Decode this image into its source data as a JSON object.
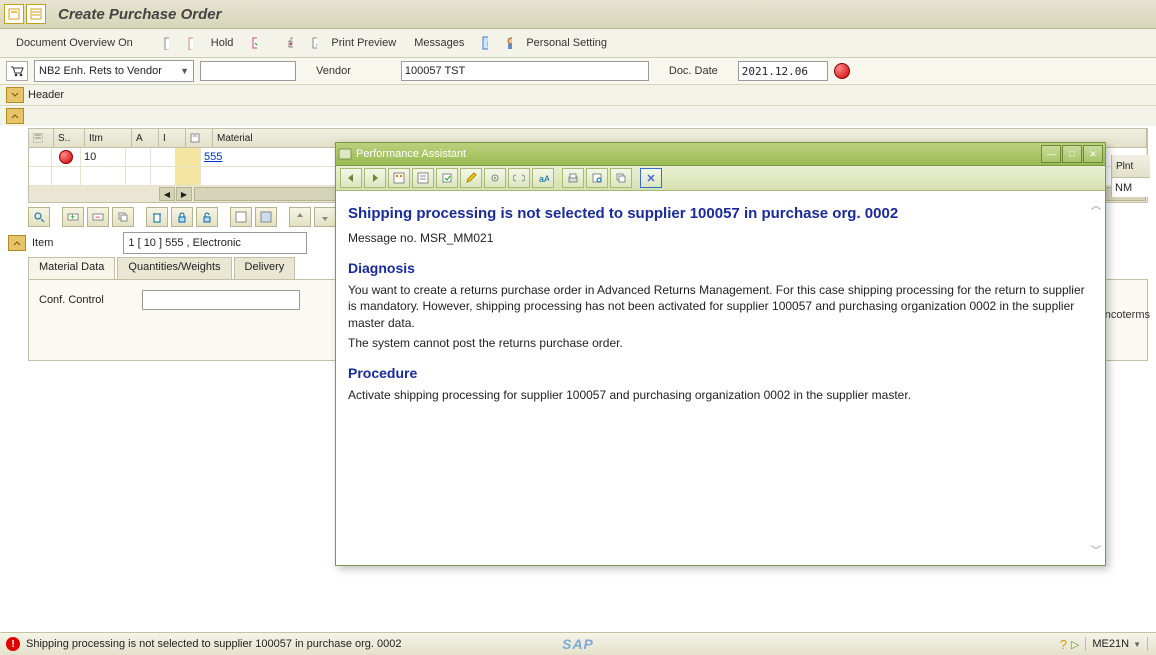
{
  "title": "Create Purchase Order",
  "toolbar": {
    "doc_overview": "Document Overview On",
    "hold": "Hold",
    "print_preview": "Print Preview",
    "messages": "Messages",
    "personal_setting": "Personal Setting"
  },
  "header": {
    "po_type": "NB2 Enh. Rets to Vendor",
    "po_number": "",
    "vendor_label": "Vendor",
    "vendor_value": "100057 TST",
    "doc_date_label": "Doc. Date",
    "doc_date_value": "2021.12.06",
    "header_label": "Header"
  },
  "grid": {
    "cols": {
      "sel": "",
      "status": "S..",
      "itm": "Itm",
      "a": "A",
      "i": "I",
      "mat_icon": "",
      "material": "Material",
      "plnt": "Plnt"
    },
    "rows": [
      {
        "status_error": true,
        "itm": "10",
        "a": "",
        "i": "",
        "material": "555",
        "plnt": "NM"
      }
    ]
  },
  "item_detail": {
    "item_label": "Item",
    "item_value": "1 [ 10 ] 555 , Electronic",
    "tabs": {
      "material_data": "Material Data",
      "quantities": "Quantities/Weights",
      "delivery": "Delivery"
    },
    "conf_control_label": "Conf. Control",
    "conf_control_value": ""
  },
  "incoterms_label": "ncoterms",
  "perf": {
    "window_title": "Performance Assistant",
    "msg_title": "Shipping processing is not selected to supplier 100057 in purchase org. 0002",
    "msg_no": "Message no. MSR_MM021",
    "diagnosis_h": "Diagnosis",
    "diagnosis_p1": "You want to create a returns purchase order in Advanced Returns Management. For this case shipping processing for the return to supplier is mandatory. However, shipping processing has not been activated for supplier 100057 and purchasing organization 0002 in the supplier master data.",
    "diagnosis_p2": "The system cannot post the returns purchase order.",
    "procedure_h": "Procedure",
    "procedure_p": "Activate shipping processing for supplier 100057 and purchasing organization 0002 in the supplier master."
  },
  "status": {
    "msg": "Shipping processing is not selected to supplier 100057 in purchase org. 0002",
    "tcode": "ME21N"
  }
}
